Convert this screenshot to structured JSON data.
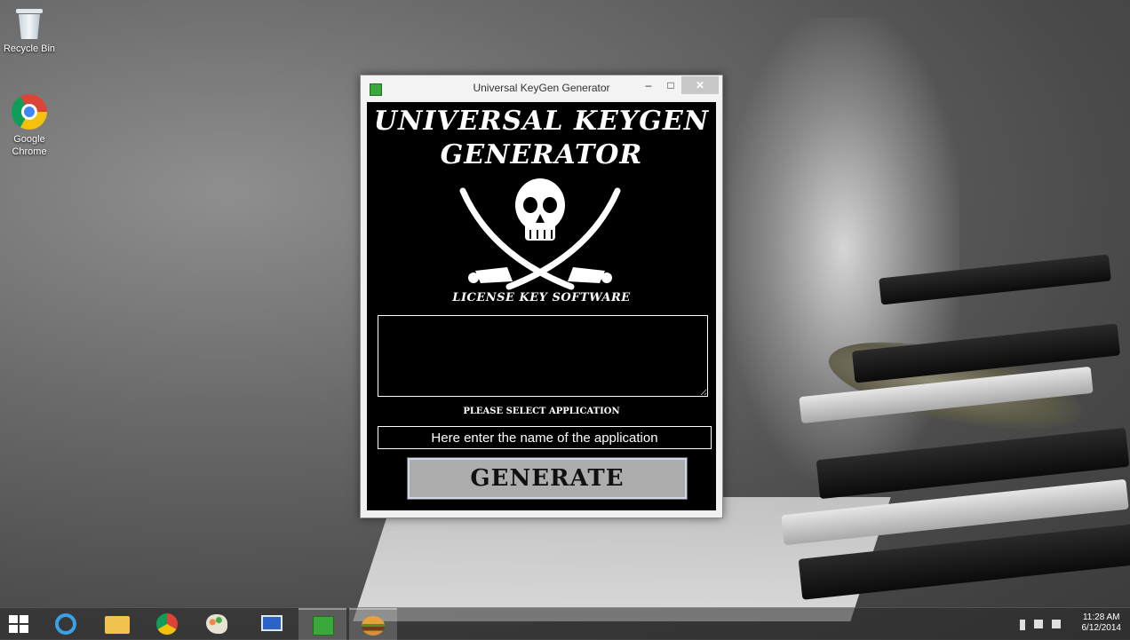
{
  "desktop": {
    "icons": [
      {
        "label": "Recycle Bin",
        "icon": "recycle-bin-icon"
      },
      {
        "label": "Google Chrome",
        "icon": "chrome-icon"
      }
    ]
  },
  "window": {
    "title": "Universal KeyGen Generator",
    "minimize": "–",
    "maximize": "□",
    "close": "✕"
  },
  "app": {
    "heading_line1": "UNIVERSAL KEYGEN",
    "heading_line2": "GENERATOR",
    "subtitle": "LICENSE KEY SOFTWARE",
    "key_output": "",
    "select_label": "PLEASE SELECT APPLICATION",
    "app_name_placeholder": "Here enter the name of the application",
    "generate_label": "GENERATE"
  },
  "taskbar": {
    "items": [
      "start-icon",
      "internet-explorer-icon",
      "file-explorer-icon",
      "chrome-icon",
      "paint-icon",
      "remote-desktop-icon",
      "keygen-app-icon",
      "burger-app-icon"
    ],
    "time": "11:28 AM",
    "date": "6/12/2014"
  }
}
